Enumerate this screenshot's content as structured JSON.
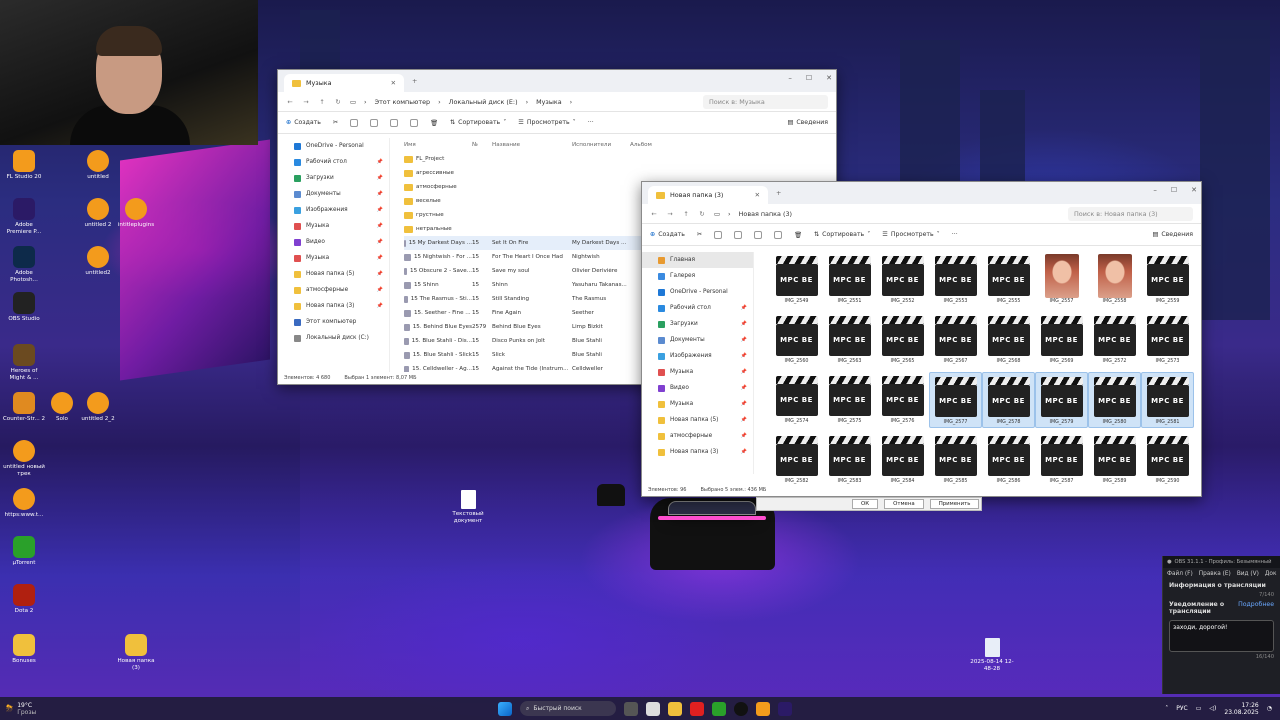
{
  "desktop": {
    "icons_left": [
      {
        "label": "FL Studio 20",
        "icon": "fl-studio-icon",
        "color": "#f39b1c"
      },
      {
        "label": "untitled",
        "icon": "fl-project-icon",
        "color": "#f39b1c"
      },
      {
        "label": "Adobe Premiere P...",
        "icon": "premiere-icon",
        "color": "#2b1a66"
      },
      {
        "label": "untitled 2",
        "icon": "fl-project-icon",
        "color": "#f39b1c"
      },
      {
        "label": "intitleplugins",
        "icon": "fl-project-icon",
        "color": "#f39b1c"
      },
      {
        "label": "Adobe Photosh...",
        "icon": "photoshop-icon",
        "color": "#0d2a4a"
      },
      {
        "label": "untitled2",
        "icon": "fl-project-icon",
        "color": "#f39b1c"
      },
      {
        "label": "OBS Studio",
        "icon": "obs-icon",
        "color": "#222"
      },
      {
        "label": "Heroes of Might & ...",
        "icon": "heroes-icon",
        "color": "#6b4a20"
      },
      {
        "label": "Counter-Str... 2",
        "icon": "cs2-icon",
        "color": "#e08a20"
      },
      {
        "label": "Solo",
        "icon": "fl-project-icon",
        "color": "#f39b1c"
      },
      {
        "label": "untitled 2_2",
        "icon": "fl-project-icon",
        "color": "#f39b1c"
      },
      {
        "label": "untitled новый трек",
        "icon": "fl-project-icon",
        "color": "#f39b1c"
      },
      {
        "label": "https:www.t...",
        "icon": "fl-project-icon",
        "color": "#f39b1c"
      },
      {
        "label": "µTorrent",
        "icon": "utorrent-icon",
        "color": "#2aa02a"
      },
      {
        "label": "Dota 2",
        "icon": "dota-icon",
        "color": "#b02010"
      },
      {
        "label": "Bonuses",
        "icon": "folder-icon",
        "color": "#f0c03c"
      },
      {
        "label": "Новая папка (3)",
        "icon": "folder-icon",
        "color": "#f0c03c"
      }
    ],
    "text_doc_label": "Текстовый документ",
    "screenshot_label": "2025-08-14 12-48-28"
  },
  "music_window": {
    "tab_title": "Музыка",
    "breadcrumb": [
      "Этот компьютер",
      "Локальный диск (E:)",
      "Музыка"
    ],
    "search_placeholder": "Поиск в: Музыка",
    "toolbar": {
      "create": "Создать",
      "sort": "Сортировать",
      "view": "Просмотреть",
      "details": "Сведения"
    },
    "sidebar": [
      "OneDrive - Personal",
      "Рабочий стол",
      "Загрузки",
      "Документы",
      "Изображения",
      "Музыка",
      "Видео",
      "Музыка",
      "Новая папка (5)",
      "атмосферные",
      "Новая папка (3)",
      "Этот компьютер",
      "Локальный диск (C:)"
    ],
    "columns": {
      "name": "Имя",
      "num": "№",
      "title": "Название",
      "artist": "Исполнители",
      "album": "Альбом"
    },
    "folders": [
      "FL_Project",
      "агрессивные",
      "атмосферные",
      "веселые",
      "грустные",
      "нетральные"
    ],
    "tracks": [
      {
        "name": "15 My Darkest Days ...",
        "num": "15",
        "title": "Set It On Fire",
        "artist": "My Darkest Days ..."
      },
      {
        "name": "15 Nightwish - For ...",
        "num": "15",
        "title": "For The Heart I Once Had",
        "artist": "Nightwish"
      },
      {
        "name": "15 Obscure 2 - Save...",
        "num": "15",
        "title": "Save my soul",
        "artist": "Olivier Derivière"
      },
      {
        "name": "15 Shinn",
        "num": "15",
        "title": "Shinn",
        "artist": "Yasuharu Takanas..."
      },
      {
        "name": "15 The Rasmus - Sti...",
        "num": "15",
        "title": "Still Standing",
        "artist": "The Rasmus"
      },
      {
        "name": "15. Seether - Fine ...",
        "num": "15",
        "title": "Fine Again",
        "artist": "Seether"
      },
      {
        "name": "15. Behind Blue Eyes",
        "num": "2579",
        "title": "Behind Blue Eyes",
        "artist": "Limp Bizkit"
      },
      {
        "name": "15. Blue Stahli - Dis...",
        "num": "15",
        "title": "Disco Punks on Jolt",
        "artist": "Blue Stahli"
      },
      {
        "name": "15. Blue Stahli - Slick",
        "num": "15",
        "title": "Slick",
        "artist": "Blue Stahli"
      },
      {
        "name": "15. Celldweller - Ag...",
        "num": "15",
        "title": "Against the Tide (Instrum...",
        "artist": "Celldweller"
      }
    ],
    "status_items": "Элементов: 4 680",
    "status_selected": "Выбран 1 элемент: 8,07 МБ"
  },
  "folder_window": {
    "tab_title": "Новая папка (3)",
    "breadcrumb": [
      "Новая папка (3)"
    ],
    "search_placeholder": "Поиск в: Новая папка (3)",
    "toolbar": {
      "create": "Создать",
      "sort": "Сортировать",
      "view": "Просмотреть",
      "details": "Сведения"
    },
    "sidebar": [
      "Главная",
      "Галерея",
      "OneDrive - Personal",
      "Рабочий стол",
      "Загрузки",
      "Документы",
      "Изображения",
      "Музыка",
      "Видео",
      "Музыка",
      "Новая папка (5)",
      "атмосферные",
      "Новая папка (3)"
    ],
    "clapper_text": "MPC BE",
    "files": [
      {
        "name": "IMG_2549",
        "type": "video"
      },
      {
        "name": "IMG_2551",
        "type": "video"
      },
      {
        "name": "IMG_2552",
        "type": "video"
      },
      {
        "name": "IMG_2553",
        "type": "video"
      },
      {
        "name": "IMG_2555",
        "type": "video"
      },
      {
        "name": "IMG_2557",
        "type": "photo"
      },
      {
        "name": "IMG_2558",
        "type": "photo"
      },
      {
        "name": "IMG_2559",
        "type": "video"
      },
      {
        "name": "IMG_2560",
        "type": "video"
      },
      {
        "name": "IMG_2563",
        "type": "video"
      },
      {
        "name": "IMG_2565",
        "type": "video"
      },
      {
        "name": "IMG_2567",
        "type": "video"
      },
      {
        "name": "IMG_2568",
        "type": "video"
      },
      {
        "name": "IMG_2569",
        "type": "video"
      },
      {
        "name": "IMG_2572",
        "type": "video"
      },
      {
        "name": "IMG_2573",
        "type": "video"
      },
      {
        "name": "IMG_2574",
        "type": "video"
      },
      {
        "name": "IMG_2575",
        "type": "video"
      },
      {
        "name": "IMG_2576",
        "type": "video"
      },
      {
        "name": "IMG_2577",
        "type": "video",
        "selected": true
      },
      {
        "name": "IMG_2578",
        "type": "video",
        "selected": true
      },
      {
        "name": "IMG_2579",
        "type": "video",
        "selected": true
      },
      {
        "name": "IMG_2580",
        "type": "video",
        "selected": true
      },
      {
        "name": "IMG_2581",
        "type": "video",
        "selected": true
      },
      {
        "name": "IMG_2582",
        "type": "video"
      },
      {
        "name": "IMG_2583",
        "type": "video"
      },
      {
        "name": "IMG_2584",
        "type": "video"
      },
      {
        "name": "IMG_2585",
        "type": "video"
      },
      {
        "name": "IMG_2586",
        "type": "video"
      },
      {
        "name": "IMG_2587",
        "type": "video"
      },
      {
        "name": "IMG_2589",
        "type": "video"
      },
      {
        "name": "IMG_2590",
        "type": "video"
      }
    ],
    "status_items": "Элементов: 96",
    "status_selected": "Выбрано 5 элем.: 436 МБ"
  },
  "dialog_buttons": {
    "ok": "ОК",
    "cancel": "Отмена",
    "apply": "Применить"
  },
  "obs": {
    "title": "OBS 31.1.1 - Профиль: Безымянный",
    "menu": [
      "Файл (F)",
      "Правка (E)",
      "Вид (V)",
      "Док"
    ],
    "section": "Информация о трансляции",
    "counter1": "7/140",
    "notify_title": "Уведомление о трансляции",
    "notify_link": "Подробнее",
    "message": "заходи, дорогой!",
    "counter2": "16/140"
  },
  "taskbar": {
    "weather_temp": "19°C",
    "weather_label": "Грозы",
    "search_placeholder": "Быстрый поиск",
    "lang": "РУС",
    "time": "17:26",
    "date": "23.08.2025"
  }
}
